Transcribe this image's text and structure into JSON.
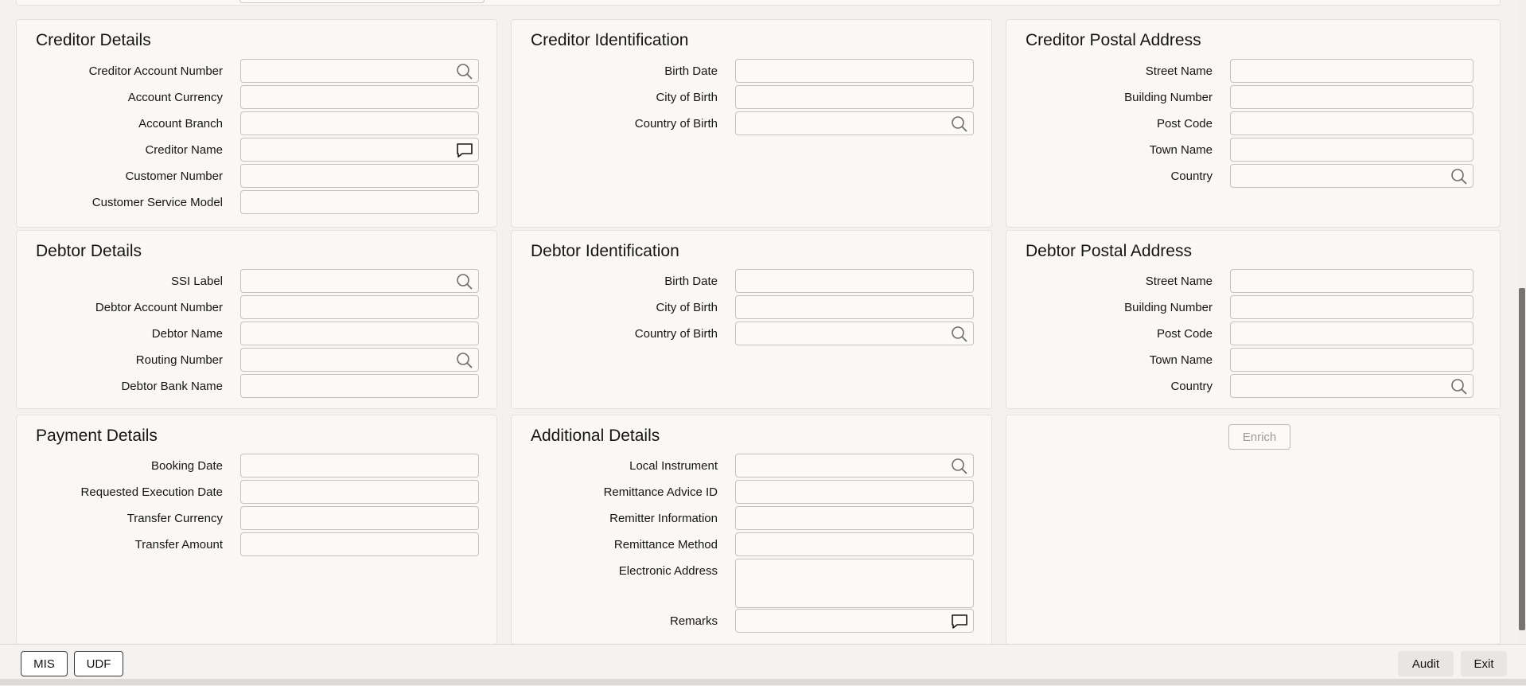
{
  "panels": {
    "creditor_details": {
      "title": "Creditor Details",
      "fields": [
        {
          "label": "Creditor Account Number",
          "value": "",
          "icon": "search-icon"
        },
        {
          "label": "Account Currency",
          "value": ""
        },
        {
          "label": "Account Branch",
          "value": ""
        },
        {
          "label": "Creditor Name",
          "value": "",
          "icon": "comment-icon"
        },
        {
          "label": "Customer Number",
          "value": ""
        },
        {
          "label": "Customer Service Model",
          "value": ""
        }
      ]
    },
    "creditor_identification": {
      "title": "Creditor Identification",
      "fields": [
        {
          "label": "Birth Date",
          "value": ""
        },
        {
          "label": "City of Birth",
          "value": ""
        },
        {
          "label": "Country of Birth",
          "value": "",
          "icon": "search-icon"
        }
      ]
    },
    "creditor_postal_address": {
      "title": "Creditor Postal Address",
      "fields": [
        {
          "label": "Street Name",
          "value": ""
        },
        {
          "label": "Building Number",
          "value": ""
        },
        {
          "label": "Post Code",
          "value": ""
        },
        {
          "label": "Town Name",
          "value": ""
        },
        {
          "label": "Country",
          "value": "",
          "icon": "search-icon"
        }
      ]
    },
    "debtor_details": {
      "title": "Debtor Details",
      "fields": [
        {
          "label": "SSI Label",
          "value": "",
          "icon": "search-icon"
        },
        {
          "label": "Debtor Account Number",
          "value": ""
        },
        {
          "label": "Debtor Name",
          "value": ""
        },
        {
          "label": "Routing Number",
          "value": "",
          "icon": "search-icon"
        },
        {
          "label": "Debtor Bank Name",
          "value": ""
        }
      ]
    },
    "debtor_identification": {
      "title": "Debtor Identification",
      "fields": [
        {
          "label": "Birth Date",
          "value": ""
        },
        {
          "label": "City of Birth",
          "value": ""
        },
        {
          "label": "Country of Birth",
          "value": "",
          "icon": "search-icon"
        }
      ]
    },
    "debtor_postal_address": {
      "title": "Debtor Postal Address",
      "fields": [
        {
          "label": "Street Name",
          "value": ""
        },
        {
          "label": "Building Number",
          "value": ""
        },
        {
          "label": "Post Code",
          "value": ""
        },
        {
          "label": "Town Name",
          "value": ""
        },
        {
          "label": "Country",
          "value": "",
          "icon": "search-icon"
        }
      ]
    },
    "payment_details": {
      "title": "Payment Details",
      "fields": [
        {
          "label": "Booking Date",
          "value": ""
        },
        {
          "label": "Requested Execution Date",
          "value": ""
        },
        {
          "label": "Transfer Currency",
          "value": ""
        },
        {
          "label": "Transfer Amount",
          "value": ""
        }
      ]
    },
    "additional_details": {
      "title": "Additional Details",
      "fields": [
        {
          "label": "Local Instrument",
          "value": "",
          "icon": "search-icon"
        },
        {
          "label": "Remittance Advice ID",
          "value": ""
        },
        {
          "label": "Remitter Information",
          "value": ""
        },
        {
          "label": "Remittance Method",
          "value": ""
        },
        {
          "label": "Electronic Address",
          "value": ""
        },
        {
          "label": "Remarks",
          "value": "",
          "icon": "comment-icon"
        }
      ]
    },
    "enrich": {
      "button_label": "Enrich"
    }
  },
  "footer": {
    "mis_label": "MIS",
    "udf_label": "UDF",
    "audit_label": "Audit",
    "exit_label": "Exit"
  }
}
